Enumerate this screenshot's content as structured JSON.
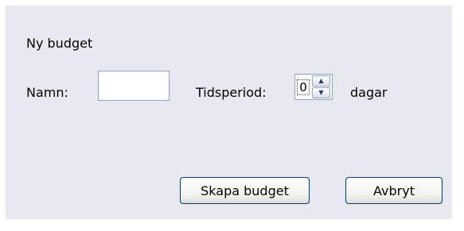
{
  "dialog": {
    "title": "Ny budget",
    "name_label": "Namn:",
    "name_value": "",
    "period_label": "Tidsperiod:",
    "period_value": "0",
    "period_unit": "dagar",
    "create_button": "Skapa budget",
    "cancel_button": "Avbryt",
    "background_color": "#e8e8f0"
  },
  "icons": {
    "spin_up": "arrow-up-icon",
    "spin_down": "arrow-down-icon"
  }
}
